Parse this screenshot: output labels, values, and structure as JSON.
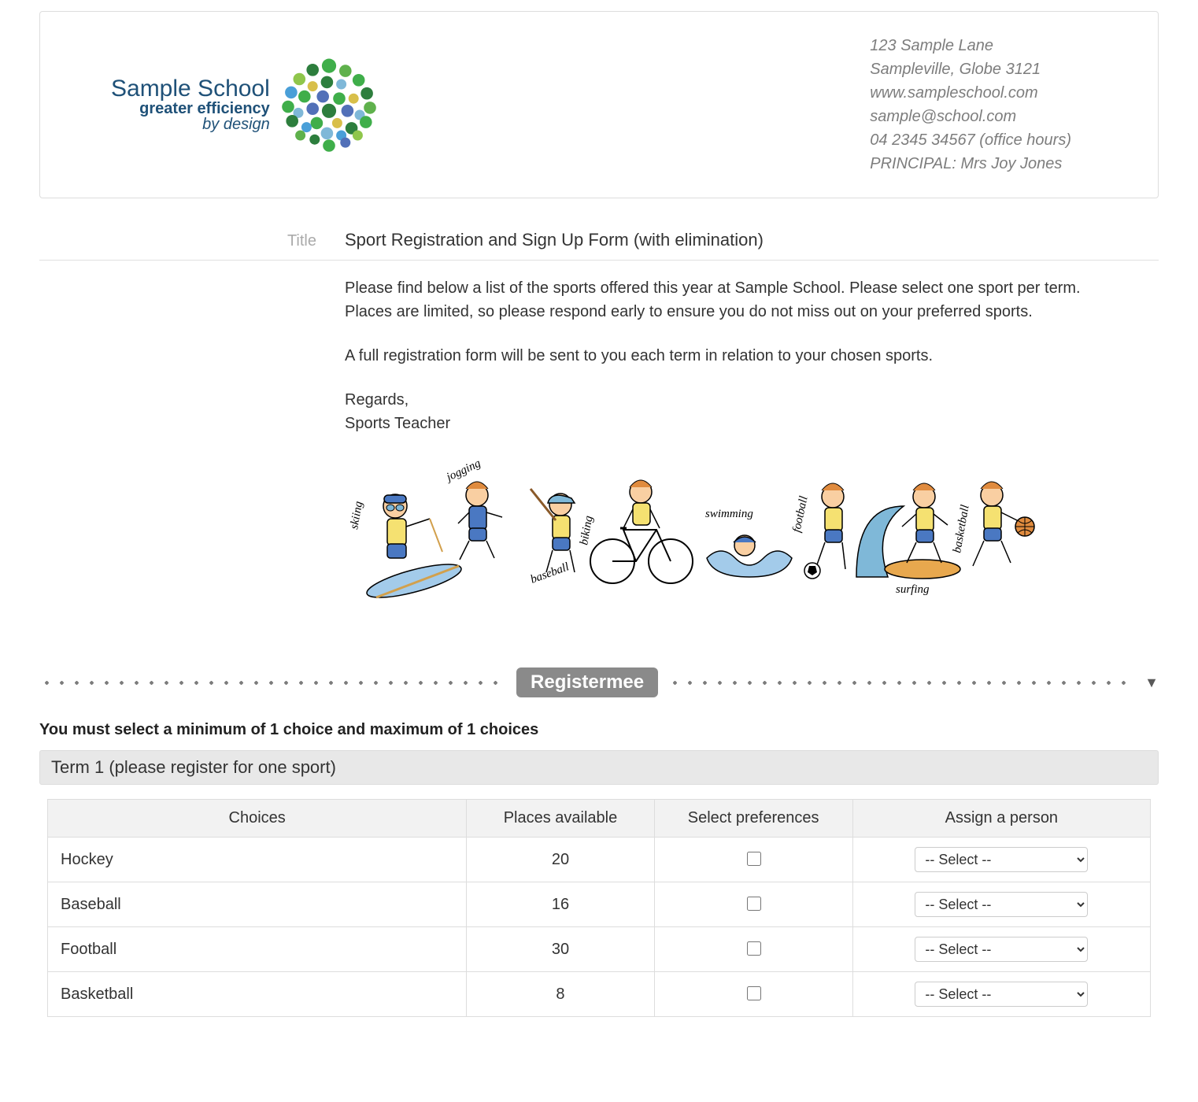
{
  "letterhead": {
    "school_name": "Sample School",
    "tagline1": "greater efficiency",
    "tagline2": "by design",
    "address1": "123 Sample Lane",
    "address2": "Sampleville, Globe 3121",
    "website": "www.sampleschool.com",
    "email": "sample@school.com",
    "phone": "04 2345 34567 (office hours)",
    "principal": "PRINCIPAL: Mrs Joy Jones"
  },
  "title_label": "Title",
  "title": "Sport Registration and Sign Up Form (with elimination)",
  "body_p1": "Please find below a list of the sports offered this year at Sample School. Please select one sport per term. Places are limited, so please respond early to ensure you do not miss out on your preferred sports.",
  "body_p2": "A full registration form will be sent to you each term in relation to your chosen sports.",
  "sign_regards": "Regards,",
  "sign_name": "Sports Teacher",
  "sports_depicted": [
    "skiing",
    "jogging",
    "baseball",
    "biking",
    "swimming",
    "football",
    "surfing",
    "basketball"
  ],
  "divider_badge": "Registermee",
  "instruction": "You must select a minimum of 1 choice and maximum of 1 choices",
  "section_header": "Term 1 (please register for one sport)",
  "table": {
    "headers": {
      "choices": "Choices",
      "places": "Places available",
      "pref": "Select preferences",
      "assign": "Assign a person"
    },
    "select_placeholder": "-- Select --",
    "rows": [
      {
        "choice": "Hockey",
        "places": "20"
      },
      {
        "choice": "Baseball",
        "places": "16"
      },
      {
        "choice": "Football",
        "places": "30"
      },
      {
        "choice": "Basketball",
        "places": "8"
      }
    ]
  }
}
